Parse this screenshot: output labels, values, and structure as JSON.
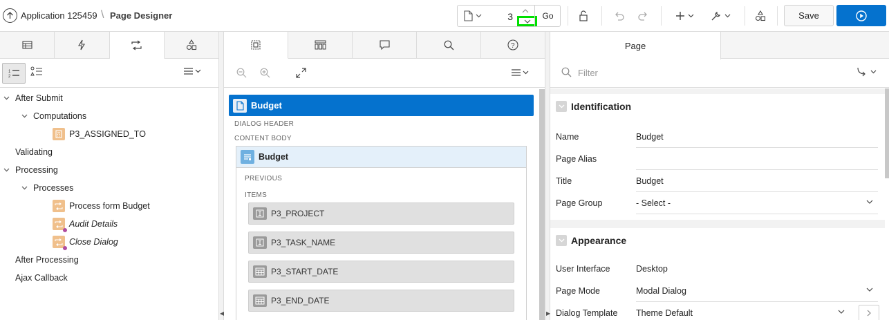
{
  "header": {
    "app_name": "Application 125459",
    "separator": "\\",
    "page_title": "Page Designer",
    "page_number": "3",
    "go_label": "Go",
    "save_label": "Save"
  },
  "left_panel": {
    "tabs": [
      "rendering-tab",
      "dynamic-actions-tab",
      "processing-tab",
      "shared-components-tab"
    ],
    "active_tab": 2,
    "tree": [
      {
        "label": "After Submit",
        "level": 0,
        "expandable": true
      },
      {
        "label": "Computations",
        "level": 1,
        "expandable": true
      },
      {
        "label": "P3_ASSIGNED_TO",
        "level": 2,
        "icon": "computation-icon"
      },
      {
        "label": "Validating",
        "level": 0
      },
      {
        "label": "Processing",
        "level": 0,
        "expandable": true
      },
      {
        "label": "Processes",
        "level": 1,
        "expandable": true
      },
      {
        "label": "Process form Budget",
        "level": 2,
        "icon": "process-icon"
      },
      {
        "label": "Audit Details",
        "level": 2,
        "icon": "process-icon",
        "italic": true,
        "conditional": true
      },
      {
        "label": "Close Dialog",
        "level": 2,
        "icon": "process-icon",
        "italic": true,
        "conditional": true
      },
      {
        "label": "After Processing",
        "level": 0
      },
      {
        "label": "Ajax Callback",
        "level": 0
      }
    ]
  },
  "middle_panel": {
    "page_name": "Budget",
    "dialog_header_label": "DIALOG HEADER",
    "content_body_label": "CONTENT BODY",
    "region_name": "Budget",
    "previous_label": "PREVIOUS",
    "items_label": "ITEMS",
    "items": [
      {
        "name": "P3_PROJECT",
        "icon": "text-field-icon"
      },
      {
        "name": "P3_TASK_NAME",
        "icon": "text-field-icon"
      },
      {
        "name": "P3_START_DATE",
        "icon": "date-picker-icon"
      },
      {
        "name": "P3_END_DATE",
        "icon": "date-picker-icon"
      }
    ]
  },
  "right_panel": {
    "tab_label": "Page",
    "filter_placeholder": "Filter",
    "groups": [
      {
        "title": "Identification",
        "rows": [
          {
            "label": "Name",
            "value": "Budget"
          },
          {
            "label": "Page Alias",
            "value": ""
          },
          {
            "label": "Title",
            "value": "Budget"
          },
          {
            "label": "Page Group",
            "value": "- Select -",
            "select": true
          }
        ]
      },
      {
        "title": "Appearance",
        "rows": [
          {
            "label": "User Interface",
            "value": "Desktop"
          },
          {
            "label": "Page Mode",
            "value": "Modal Dialog",
            "select": true
          },
          {
            "label": "Dialog Template",
            "value": "Theme Default",
            "select": true
          }
        ]
      }
    ]
  },
  "colors": {
    "accent": "#0572ce",
    "highlight": "#00e000",
    "process_icon": "#f0c08c",
    "conditional_dot": "#b04ea0"
  }
}
